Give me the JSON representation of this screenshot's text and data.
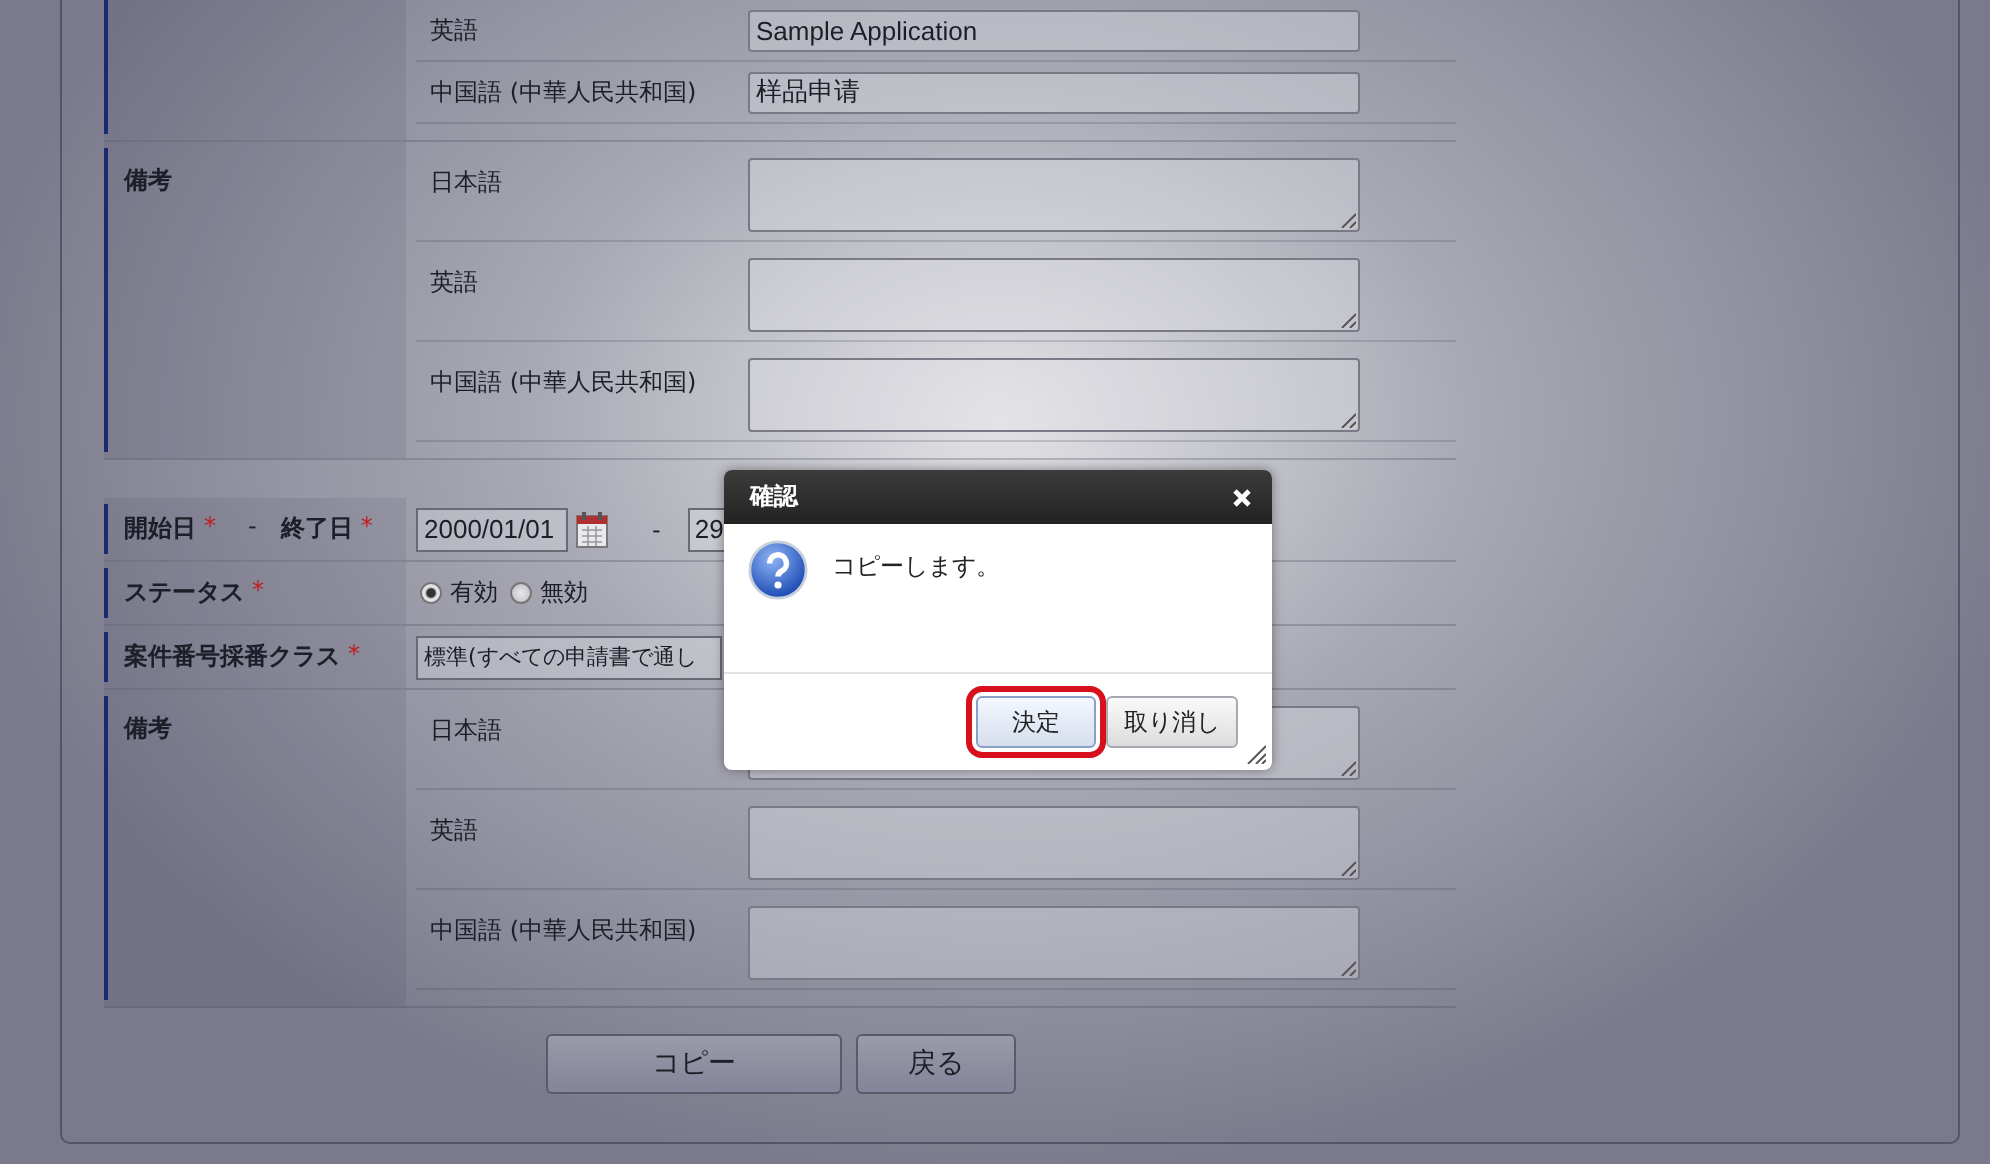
{
  "form": {
    "sections": [
      {
        "kind": "group",
        "rows": [
          {
            "kind": "input",
            "label": "英語",
            "value": "Sample Application"
          },
          {
            "kind": "input",
            "label": "中国語 (中華人民共和国)",
            "value": "样品申请"
          }
        ]
      },
      {
        "kind": "group",
        "label": "備考",
        "rows": [
          {
            "kind": "textarea",
            "label": "日本語"
          },
          {
            "kind": "textarea",
            "label": "英語"
          },
          {
            "kind": "textarea",
            "label": "中国語 (中華人民共和国)"
          }
        ]
      },
      {
        "kind": "date_range",
        "label": "開始日",
        "required_mark": "*",
        "dash": "-",
        "end_label": "終了日",
        "end_required_mark": "*",
        "start": "2000/01/01",
        "range_dash": "-",
        "end": "29"
      },
      {
        "kind": "radio",
        "label": "ステータス",
        "required_mark": "*",
        "options": [
          {
            "label": "有効",
            "selected": true
          },
          {
            "label": "無効",
            "selected": false
          }
        ]
      },
      {
        "kind": "select",
        "label": "案件番号採番クラス",
        "required_mark": "*",
        "value": "標準(すべての申請書で通し"
      },
      {
        "kind": "group",
        "label": "備考",
        "rows": [
          {
            "kind": "textarea",
            "label": "日本語"
          },
          {
            "kind": "textarea",
            "label": "英語"
          },
          {
            "kind": "textarea",
            "label": "中国語 (中華人民共和国)"
          }
        ]
      }
    ],
    "buttons": [
      {
        "label": "コピー"
      },
      {
        "label": "戻る"
      }
    ]
  },
  "dialog": {
    "title": "確認",
    "message": "コピーします。",
    "buttons": [
      {
        "label": "決定",
        "highlighted": true
      },
      {
        "label": "取り消し",
        "highlighted": false
      }
    ]
  }
}
